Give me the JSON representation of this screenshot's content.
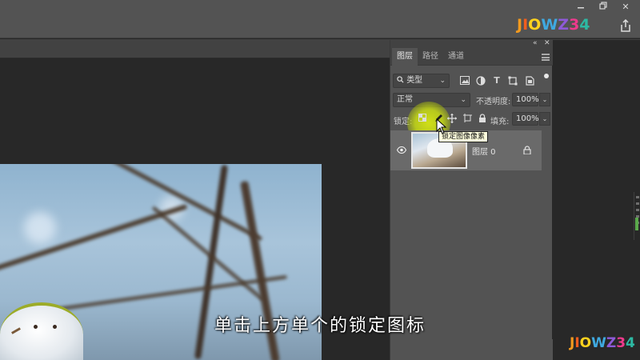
{
  "window": {
    "minimize_icon": "minimize-icon",
    "restore_icon": "restore-icon",
    "close_label": "✕"
  },
  "brand": {
    "letters": [
      "J",
      "I",
      "O",
      "W",
      "Z",
      "3",
      "4"
    ],
    "colors": [
      "#f39a1e",
      "#f35d1e",
      "#ffd21e",
      "#3fa9e0",
      "#8e5ad8",
      "#ee3a8c",
      "#2db9a3"
    ]
  },
  "panel": {
    "collapse_label": "«",
    "close_label": "✕",
    "tabs": [
      {
        "label": "图层"
      },
      {
        "label": "路径"
      },
      {
        "label": "通道"
      }
    ],
    "filter": {
      "search_icon": "search-icon",
      "value": "类型",
      "icons": [
        "image-filter-icon",
        "adjustment-filter-icon",
        "text-filter-icon",
        "shape-filter-icon",
        "smartobject-filter-icon"
      ]
    },
    "blend": {
      "value": "正常",
      "opacity_label": "不透明度:",
      "opacity_value": "100%"
    },
    "lock": {
      "label": "锁定:",
      "fill_label": "填充:",
      "fill_value": "100%",
      "tooltip": "锁定图像像素"
    },
    "layer": {
      "name": "图层 0"
    }
  },
  "subtitle": "单击上方单个的锁定图标"
}
